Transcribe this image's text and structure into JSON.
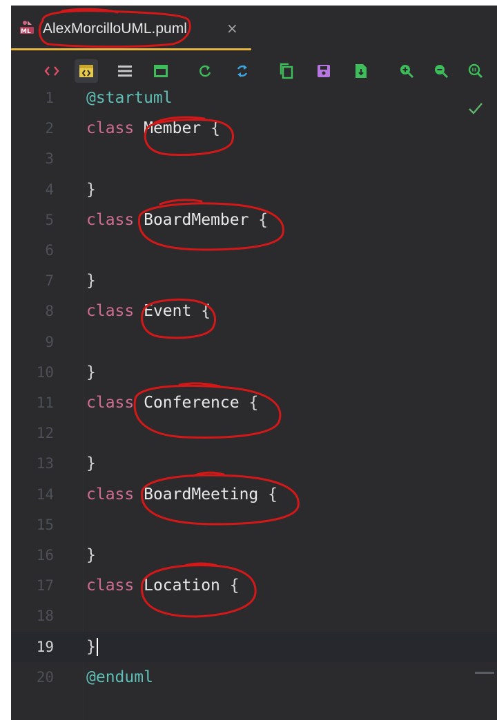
{
  "tab": {
    "title": "AlexMorcilloUML.puml",
    "close": "×"
  },
  "toolbar": {
    "buttons": [
      {
        "name": "source-view-icon",
        "color": "#e0506a"
      },
      {
        "name": "split-view-icon",
        "color": "#e6c84a"
      },
      {
        "name": "text-only-icon",
        "color": "#c8c8c8"
      },
      {
        "name": "preview-only-icon",
        "color": "#3dbe5a"
      },
      {
        "name": "refresh-icon",
        "color": "#3dbe5a"
      },
      {
        "name": "sync-icon",
        "color": "#3aa6e0"
      },
      {
        "name": "copy-icon",
        "color": "#3dbe5a"
      },
      {
        "name": "save-icon",
        "color": "#b678e0"
      },
      {
        "name": "export-icon",
        "color": "#3dbe5a"
      },
      {
        "name": "zoom-in-icon",
        "color": "#3dbe5a"
      },
      {
        "name": "zoom-out-icon",
        "color": "#3dbe5a"
      },
      {
        "name": "actual-size-icon",
        "color": "#3dbe5a"
      }
    ]
  },
  "editor": {
    "current_line": 19,
    "status": "check-icon",
    "lines": [
      {
        "num": "1",
        "dir": "@startuml"
      },
      {
        "num": "2",
        "kw": "class",
        "name": "Member",
        "brace": "{"
      },
      {
        "num": "3"
      },
      {
        "num": "4",
        "brace": "}"
      },
      {
        "num": "5",
        "kw": "class",
        "name": "BoardMember",
        "brace": "{"
      },
      {
        "num": "6"
      },
      {
        "num": "7",
        "brace": "}"
      },
      {
        "num": "8",
        "kw": "class",
        "name": "Event",
        "brace": "{"
      },
      {
        "num": "9"
      },
      {
        "num": "10",
        "brace": "}"
      },
      {
        "num": "11",
        "kw": "class",
        "name": "Conference",
        "brace": "{"
      },
      {
        "num": "12"
      },
      {
        "num": "13",
        "brace": "}"
      },
      {
        "num": "14",
        "kw": "class",
        "name": "BoardMeeting",
        "brace": "{"
      },
      {
        "num": "15"
      },
      {
        "num": "16",
        "brace": "}"
      },
      {
        "num": "17",
        "kw": "class",
        "name": "Location",
        "brace": "{"
      },
      {
        "num": "18"
      },
      {
        "num": "19",
        "brace": "}"
      },
      {
        "num": "20",
        "dir": "@enduml"
      }
    ]
  },
  "colors": {
    "background": "#2b2b2d",
    "keyword": "#cf6d8e",
    "directive": "#5fbfb6",
    "annotation": "#d21818",
    "tab_underline": "#e6b440"
  }
}
